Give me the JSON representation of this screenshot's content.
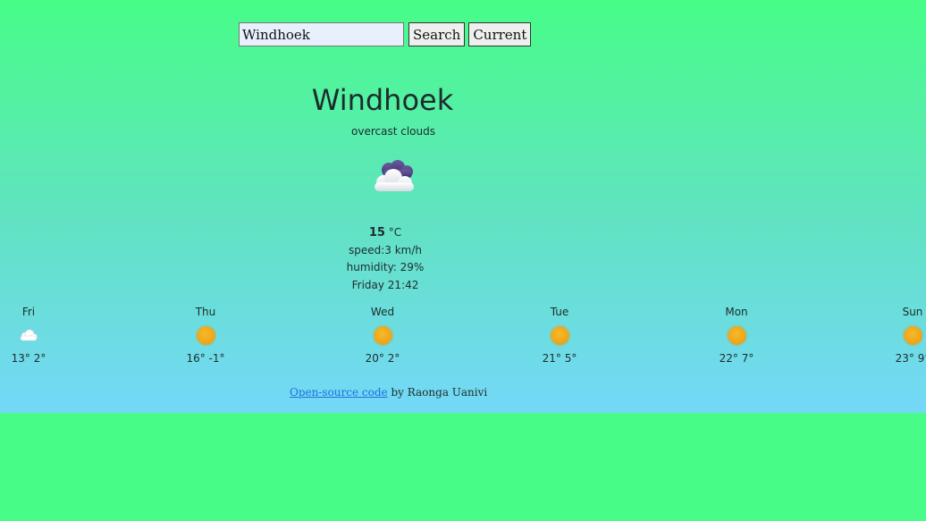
{
  "search": {
    "value": "Windhoek",
    "search_label": "Search",
    "current_label": "Current"
  },
  "weather": {
    "city": "Windhoek",
    "description": "overcast clouds",
    "icon": "overcast-clouds-icon",
    "temperature": "15",
    "unit": "°C",
    "speed": "speed:3 km/h",
    "humidity": "humidity: 29%",
    "datetime": "Friday 21:42"
  },
  "forecast": [
    {
      "day": "Fri",
      "temps": "13° 2°",
      "icon": "cloud-icon"
    },
    {
      "day": "Thu",
      "temps": "16° -1°",
      "icon": "sun-icon"
    },
    {
      "day": "Wed",
      "temps": "20° 2°",
      "icon": "sun-icon"
    },
    {
      "day": "Tue",
      "temps": "21° 5°",
      "icon": "sun-icon"
    },
    {
      "day": "Mon",
      "temps": "22° 7°",
      "icon": "sun-icon"
    },
    {
      "day": "Sun",
      "temps": "23° 9°",
      "icon": "sun-icon"
    }
  ],
  "footer": {
    "link_text": "Open-source code",
    "author_text": " by Raonga Uanivi"
  },
  "colors": {
    "background_top": "#47fd88",
    "background_bottom": "#74d8f8",
    "sun": "#eda81d",
    "link": "#1f6de0"
  }
}
